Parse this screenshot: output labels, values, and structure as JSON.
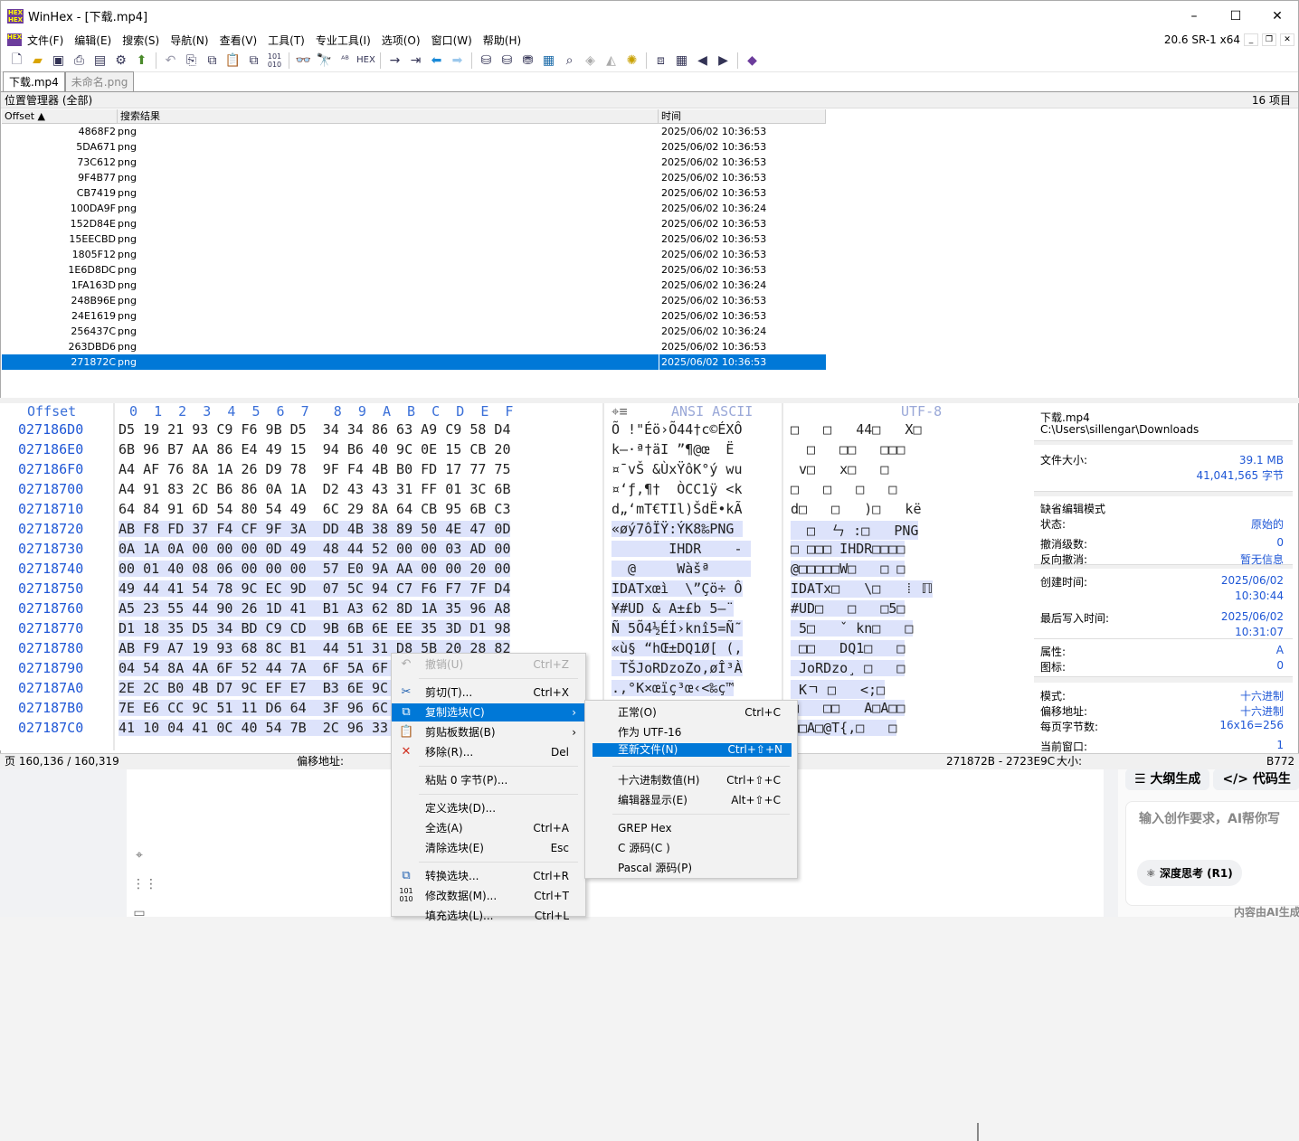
{
  "window": {
    "title": "WinHex - [下载.mp4]",
    "version": "20.6 SR-1 x64",
    "minimize": "–",
    "maximize": "☐",
    "close": "✕"
  },
  "menu": [
    "文件(F)",
    "编辑(E)",
    "搜索(S)",
    "导航(N)",
    "查看(V)",
    "工具(T)",
    "专业工具(I)",
    "选项(O)",
    "窗口(W)",
    "帮助(H)"
  ],
  "tabs": [
    "下载.mp4",
    "未命名.png"
  ],
  "position_manager": {
    "title": "位置管理器 (全部)",
    "count": "16 项目",
    "columns": [
      "Offset ▲",
      "搜索结果",
      "时间"
    ],
    "rows": [
      {
        "offset": "4868F2",
        "result": "png",
        "time": "2025/06/02  10:36:53"
      },
      {
        "offset": "5DA671",
        "result": "png",
        "time": "2025/06/02  10:36:53"
      },
      {
        "offset": "73C612",
        "result": "png",
        "time": "2025/06/02  10:36:53"
      },
      {
        "offset": "9F4B77",
        "result": "png",
        "time": "2025/06/02  10:36:53"
      },
      {
        "offset": "CB7419",
        "result": "png",
        "time": "2025/06/02  10:36:53"
      },
      {
        "offset": "100DA9F",
        "result": "png",
        "time": "2025/06/02  10:36:24"
      },
      {
        "offset": "152D84E",
        "result": "png",
        "time": "2025/06/02  10:36:53"
      },
      {
        "offset": "15EECBD",
        "result": "png",
        "time": "2025/06/02  10:36:53"
      },
      {
        "offset": "1805F12",
        "result": "png",
        "time": "2025/06/02  10:36:53"
      },
      {
        "offset": "1E6D8DC",
        "result": "png",
        "time": "2025/06/02  10:36:53"
      },
      {
        "offset": "1FA163D",
        "result": "png",
        "time": "2025/06/02  10:36:24"
      },
      {
        "offset": "248B96E",
        "result": "png",
        "time": "2025/06/02  10:36:53"
      },
      {
        "offset": "24E1619",
        "result": "png",
        "time": "2025/06/02  10:36:53"
      },
      {
        "offset": "256437C",
        "result": "png",
        "time": "2025/06/02  10:36:24"
      },
      {
        "offset": "263DBD6",
        "result": "png",
        "time": "2025/06/02  10:36:53"
      },
      {
        "offset": "271872C",
        "result": "png",
        "time": "2025/06/02  10:36:53"
      }
    ]
  },
  "hex": {
    "header_offset": "Offset",
    "header_cols": "0  1  2  3  4  5  6  7   8  9  A  B  C  D  E  F",
    "header_ansi": "ANSI ASCII",
    "header_utf": "UTF-8",
    "rows": [
      {
        "offset": "027186D0",
        "bytes": "D5 19 21 93 C9 F6 9B D5  34 34 86 63 A9 C9 58 D4",
        "ansi": "Õ !\"Éö›Õ44†c©ÉXÔ",
        "utf": "□   □   44□   X□"
      },
      {
        "offset": "027186E0",
        "bytes": "6B 96 B7 AA 86 E4 49 15  94 B6 40 9C 0E 15 CB 20",
        "ansi": "k–·ª†äI ”¶@œ  Ë ",
        "utf": "  □   □□   □□□"
      },
      {
        "offset": "027186F0",
        "bytes": "A4 AF 76 8A 1A 26 D9 78  9F F4 4B B0 FD 17 77 75",
        "ansi": "¤¯vŠ &ÙxŸôK°ý wu",
        "utf": " v□   x□   □"
      },
      {
        "offset": "02718700",
        "bytes": "A4 91 83 2C B6 86 0A 1A  D2 43 43 31 FF 01 3C 6B",
        "ansi": "¤‘ƒ,¶†  ÒCC1ÿ <k",
        "utf": "□   □   □   □"
      },
      {
        "offset": "02718710",
        "bytes": "64 84 91 6D 54 80 54 49  6C 29 8A 64 CB 95 6B C3",
        "ansi": "d„‘mT€TIl)ŠdË•kÃ",
        "utf": "d□   □   )□   kë"
      },
      {
        "offset": "02718720",
        "bytes": "AB F8 FD 37 F4 CF 9F 3A  DD 4B 38 89 50 4E 47 0D",
        "ansi": "«øý7ôÏŸ:ÝK8‰PNG ",
        "utf": "  □  ㄣ :□   PNG"
      },
      {
        "offset": "02718730",
        "bytes": "0A 1A 0A 00 00 00 0D 49  48 44 52 00 00 03 AD 00",
        "ansi": "       IHDR    - ",
        "utf": "□ □□□ IHDR□□□□"
      },
      {
        "offset": "02718740",
        "bytes": "00 01 40 08 06 00 00 00  57 E0 9A AA 00 00 20 00",
        "ansi": "  @     Wàšª     ",
        "utf": "@□□□□□W□   □ □"
      },
      {
        "offset": "02718750",
        "bytes": "49 44 41 54 78 9C EC 9D  07 5C 94 C7 F6 F7 7F D4",
        "ansi": "IDATxœì  \\”Çö÷ Ô",
        "utf": "IDATx□   \\□   ⁞ ℿ"
      },
      {
        "offset": "02718760",
        "bytes": "A5 23 55 44 90 26 1D 41  B1 A3 62 8D 1A 35 96 A8",
        "ansi": "¥#UD & A±£b 5–¨",
        "utf": "#UD□   □   □5□"
      },
      {
        "offset": "02718770",
        "bytes": "D1 18 35 D5 34 BD C9 CD  9B 6B 6E EE 35 3D D1 98",
        "ansi": "Ñ 5Õ4½ÉÍ›knî5=Ñ˜",
        "utf": " 5□   ˇ kn□   □"
      },
      {
        "offset": "02718780",
        "bytes": "AB F9 A7 19 93 68 8C B1  44 51 31 D8 5B 20 28 82",
        "ansi": "«ù§ “hŒ±DQ1Ø[ (,",
        "utf": " □□   DQ1□   □"
      },
      {
        "offset": "02718790",
        "bytes": "04 54 8A 4A 6F 52 44 7A  6F 5A 6F 82 F8 CE B3 C0",
        "ansi": " TŠJoRDzoZo‚øÎ³À",
        "utf": " JoRDzo¸ □   □"
      },
      {
        "offset": "027187A0",
        "bytes": "2E 2C B0 4B D7 9C EF E7  B3 6E 9C 8B 3C 89 E7 99",
        "ansi": ".,°K×œïç³œ‹<‰ç™",
        "utf": " Kㄱ □   <;□"
      },
      {
        "offset": "027187B0",
        "bytes": "7E E6 CC 9C 51 11 D6 64  3F 96 6C F3 41 0B 41 87",
        "ansi": "~æÌœQ Öd?–lóA A‡",
        "utf": "□   □□   A□A□□"
      },
      {
        "offset": "027187C0",
        "bytes": "41 10 04 41 0C 40 54 7B  2C 96 33 E6 80 8D 41 40",
        "ansi": "A  A @T{,–3æ€ A@",
        "utf": "□□A□@T{,□   □"
      }
    ]
  },
  "info": {
    "file_name": "下载.mp4",
    "path": "C:\\Users\\sillengar\\Downloads",
    "size_label": "文件大小:",
    "size_mb": "39.1 MB",
    "size_bytes": "41,041,565 字节",
    "edit_mode_label": "缺省编辑模式",
    "state_label": "状态:",
    "state": "原始的",
    "undo_label": "撤消级数:",
    "undo": "0",
    "redo_label": "反向撤消:",
    "redo": "暂无信息",
    "created_label": "创建时间:",
    "created_date": "2025/06/02",
    "created_time": "10:30:44",
    "written_label": "最后写入时间:",
    "written_date": "2025/06/02",
    "written_time": "10:31:07",
    "attr_label": "属性:",
    "attr": "A",
    "icon_label": "图标:",
    "icon": "0",
    "mode_label": "模式:",
    "mode": "十六进制",
    "offset_label": "偏移地址:",
    "offset": "十六进制",
    "bpp_label": "每页字节数:",
    "bpp": "16x16=256",
    "curwin_label": "当前窗口:",
    "curwin": "1"
  },
  "status": {
    "page": "页 160,136 / 160,319",
    "offset_label": "偏移地址:",
    "range": "271872B - 2723E9C",
    "size_label": "大小:",
    "size": "B772"
  },
  "context_menu": {
    "undo": "撤销(U)",
    "undo_sc": "Ctrl+Z",
    "cut": "剪切(T)...",
    "cut_sc": "Ctrl+X",
    "copy_sel": "复制选块(C)",
    "clipboard": "剪贴板数据(B)",
    "remove": "移除(R)...",
    "remove_sc": "Del",
    "paste0": "粘贴 0 字节(P)...",
    "define": "定义选块(D)...",
    "select_all": "全选(A)",
    "select_all_sc": "Ctrl+A",
    "clear_sel": "清除选块(E)",
    "clear_sel_sc": "Esc",
    "convert": "转换选块...",
    "convert_sc": "Ctrl+R",
    "modify": "修改数据(M)...",
    "modify_sc": "Ctrl+T",
    "fill": "填充选块(L)...",
    "fill_sc": "Ctrl+L"
  },
  "submenu": {
    "normal": "正常(O)",
    "normal_sc": "Ctrl+C",
    "utf16": "作为 UTF-16",
    "newfile": "至新文件(N)",
    "newfile_sc": "Ctrl+⇧+N",
    "hexval": "十六进制数值(H)",
    "hexval_sc": "Ctrl+⇧+C",
    "editor": "编辑器显示(E)",
    "editor_sc": "Alt+⇧+C",
    "grep": "GREP Hex",
    "csrc": "C 源码(C )",
    "pascal": "Pascal 源码(P)"
  },
  "background": {
    "tab_outline": "大纲生成",
    "tab_code": "代码生",
    "placeholder": "输入创作要求，AI帮你写",
    "deep": "深度思考 (R1)",
    "footer": "内容由AI生成"
  }
}
